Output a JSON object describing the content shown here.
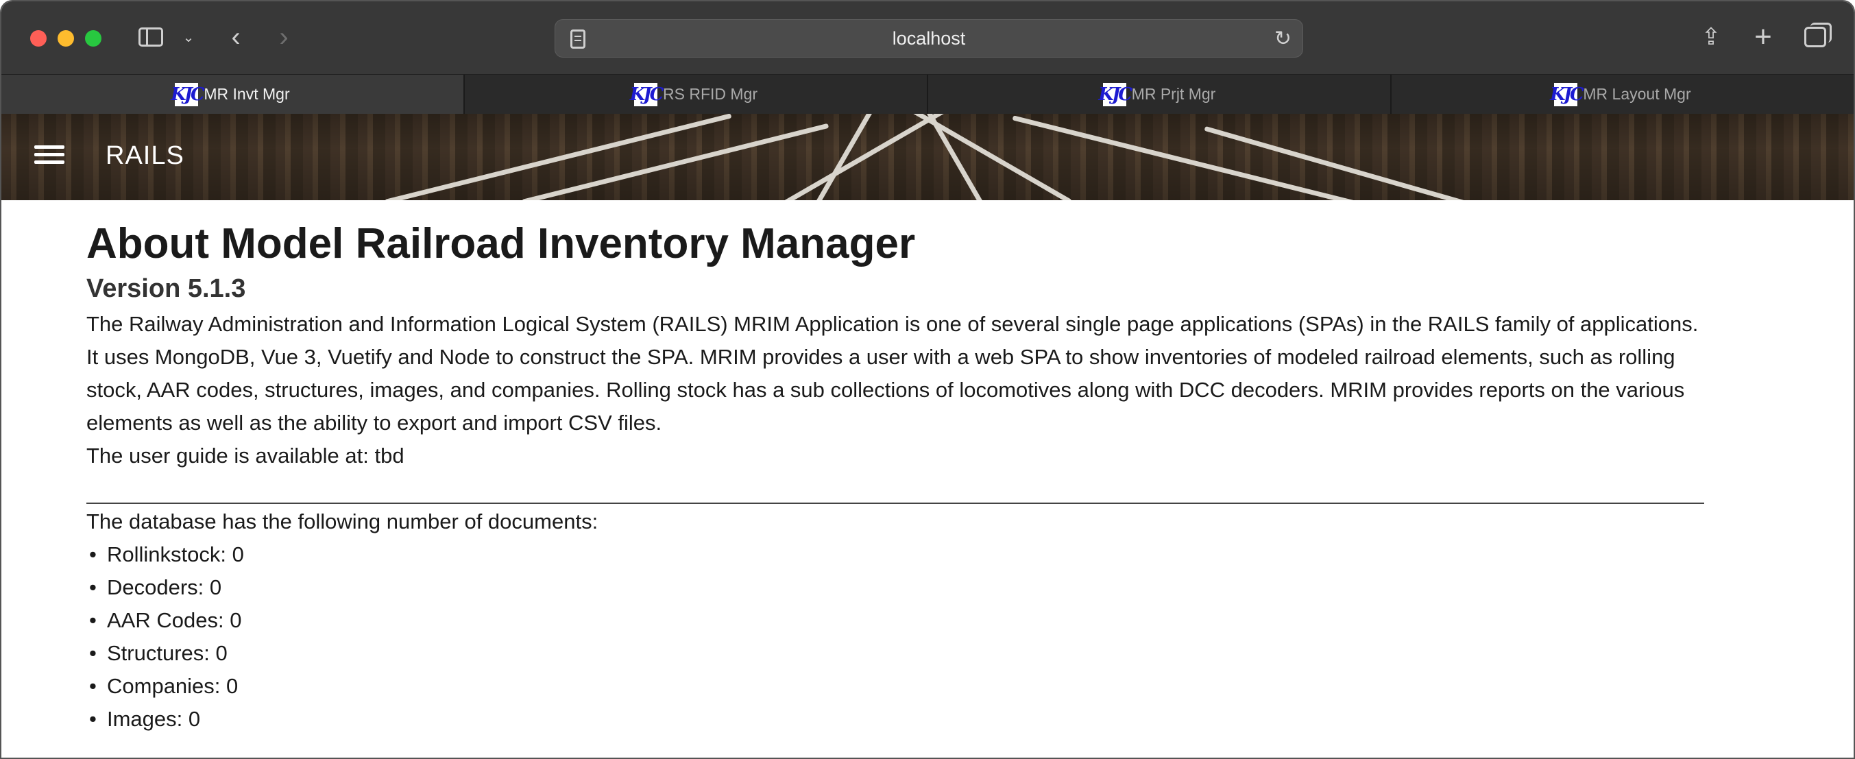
{
  "browser": {
    "url": "localhost",
    "tabs": [
      {
        "label": "MR Invt Mgr",
        "active": true
      },
      {
        "label": "RS RFID Mgr",
        "active": false
      },
      {
        "label": "MR Prjt Mgr",
        "active": false
      },
      {
        "label": "MR Layout Mgr",
        "active": false
      }
    ],
    "favicon_text": "KJC"
  },
  "appbar": {
    "title": "RAILS"
  },
  "page": {
    "heading": "About Model Railroad Inventory Manager",
    "version": "Version 5.1.3",
    "description": "The Railway Administration and Information Logical System (RAILS) MRIM Application is one of several single page applications (SPAs) in the RAILS family of applications. It uses MongoDB, Vue 3, Vuetify and Node to construct the SPA. MRIM provides a user with a web SPA to show inventories of modeled railroad elements, such as rolling stock, AAR codes, structures, images, and companies. Rolling stock has a sub collections of locomotives along with DCC decoders. MRIM provides reports on the various elements as well as the ability to export and import CSV files.",
    "guide": "The user guide is available at: tbd",
    "db_intro": "The database has the following number of documents:",
    "counts": [
      "Rollinkstock: 0",
      "Decoders: 0",
      "AAR Codes: 0",
      "Structures: 0",
      "Companies: 0",
      "Images: 0"
    ]
  },
  "colors": {
    "titlebar": "#383838",
    "tabstrip": "#2a2a2a",
    "close": "#ff5f57",
    "minimize": "#febc2e",
    "zoom": "#28c840"
  }
}
